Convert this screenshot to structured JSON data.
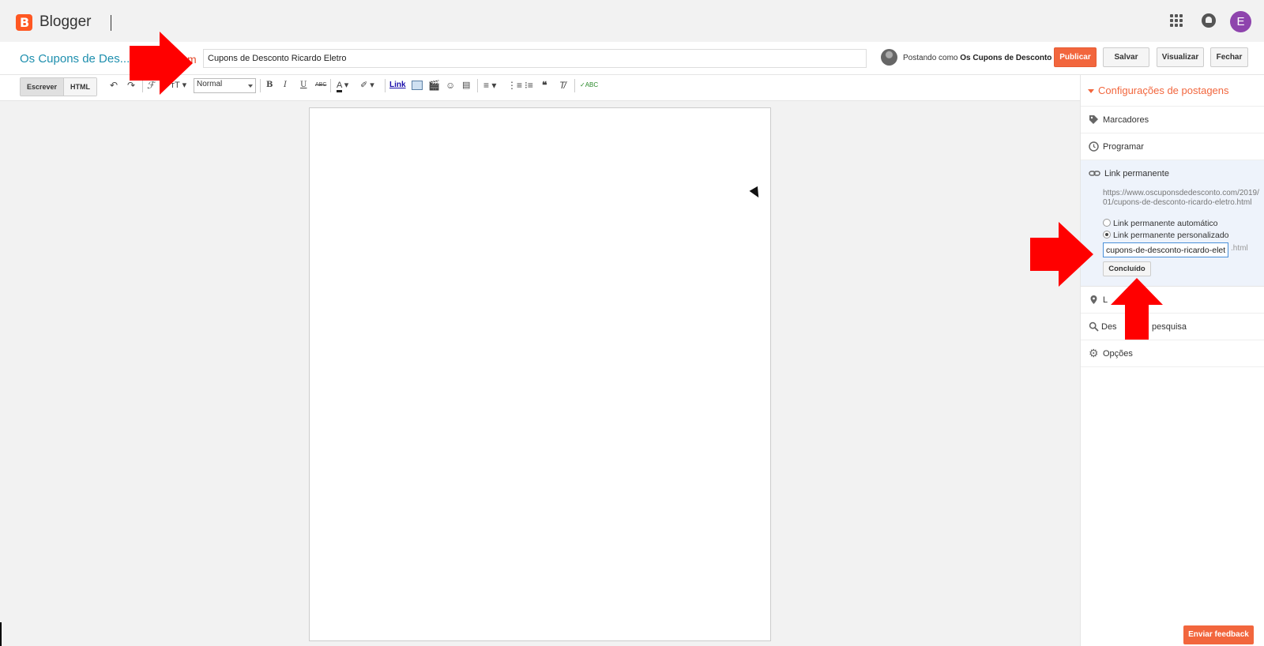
{
  "app": {
    "brand": "Blogger",
    "avatar_letter": "E",
    "brand_color": "#ff5722"
  },
  "post_header": {
    "blog_name": "Os Cupons de Des...",
    "blog_name_tail": "m",
    "title_value": "Cupons de Desconto Ricardo Eletro",
    "posting_as_label": "Postando como",
    "posting_as_name": "Os Cupons de Desconto",
    "buttons": {
      "publish": "Publicar",
      "save": "Salvar",
      "preview": "Visualizar",
      "close": "Fechar"
    }
  },
  "toolbar": {
    "compose": "Escrever",
    "html": "HTML",
    "font_size_value": "Normal",
    "bold": "B",
    "italic": "I",
    "underline": "U",
    "strike": "ABC",
    "link": "Link",
    "font_icon": "ℱ",
    "size_icon": "тT"
  },
  "sidebar": {
    "header": "Configurações de postagens",
    "items": [
      {
        "label": "Marcadores",
        "icon": "tag-icon"
      },
      {
        "label": "Programar",
        "icon": "clock-icon"
      },
      {
        "label": "Link permanente",
        "icon": "link-icon"
      },
      {
        "label": "L",
        "icon": "location-pin-icon"
      },
      {
        "label": "Des",
        "label_tail": "pesquisa",
        "icon": "search-icon"
      },
      {
        "label": "Opções",
        "icon": "gear-icon"
      }
    ],
    "permalink": {
      "url": "https://www.oscuponsdedesconto.com/2019/01/cupons-de-desconto-ricardo-eletro.html",
      "option_auto": "Link permanente automático",
      "option_custom": "Link permanente personalizado",
      "selected": "custom",
      "slug_value": "cupons-de-desconto-ricardo-eletro",
      "suffix": ".html",
      "done": "Concluído"
    }
  },
  "feedback": "Enviar feedback",
  "colors": {
    "accent": "#f2663d",
    "blog_link": "#1e8fae",
    "arrow": "#ff0000"
  }
}
